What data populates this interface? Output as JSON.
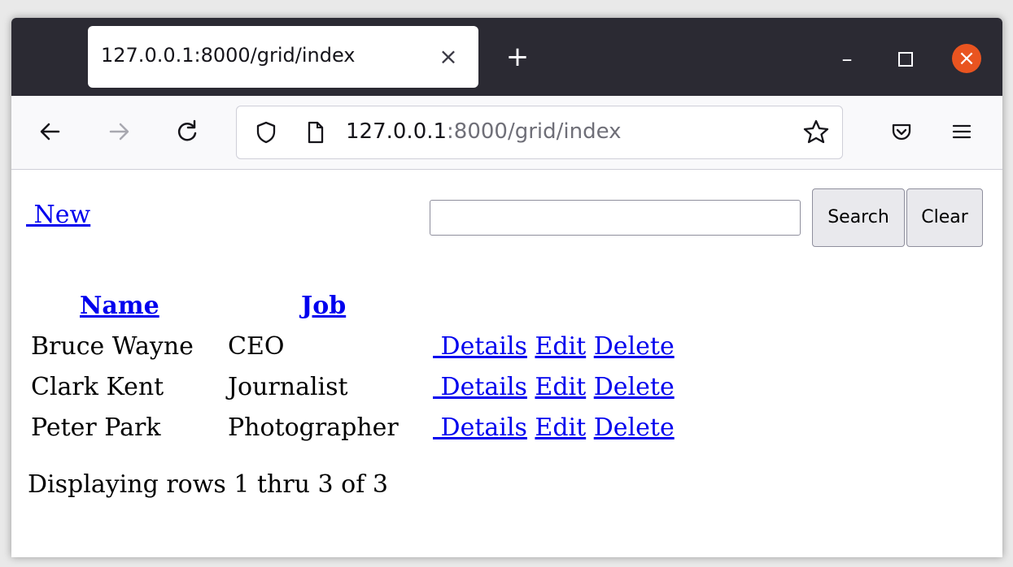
{
  "browser": {
    "tab_title": "127.0.0.1:8000/grid/index",
    "tab_close": "×",
    "new_tab": "+",
    "url_host": "127.0.0.1",
    "url_rest": ":8000/grid/index",
    "icons": {
      "back": "back-arrow-icon",
      "forward": "forward-arrow-icon",
      "reload": "reload-icon",
      "shield": "tracking-protection-shield-icon",
      "page": "page-icon",
      "bookmark": "bookmark-star-icon",
      "pocket": "pocket-icon",
      "menu": "hamburger-menu-icon"
    },
    "window_controls": {
      "minimize": "–",
      "close": "×"
    }
  },
  "page": {
    "new_link": " New",
    "search": {
      "value": "",
      "placeholder": ""
    },
    "search_button": "Search",
    "clear_button": "Clear",
    "columns": [
      "Name",
      "Job"
    ],
    "rows": [
      {
        "name": "Bruce Wayne",
        "job": "CEO",
        "actions": [
          " Details",
          "Edit",
          "Delete"
        ]
      },
      {
        "name": "Clark Kent",
        "job": "Journalist",
        "actions": [
          " Details",
          "Edit",
          "Delete"
        ]
      },
      {
        "name": "Peter Park",
        "job": "Photographer",
        "actions": [
          " Details",
          "Edit",
          "Delete"
        ]
      }
    ],
    "status_text": "Displaying rows 1 thru 3 of 3"
  }
}
